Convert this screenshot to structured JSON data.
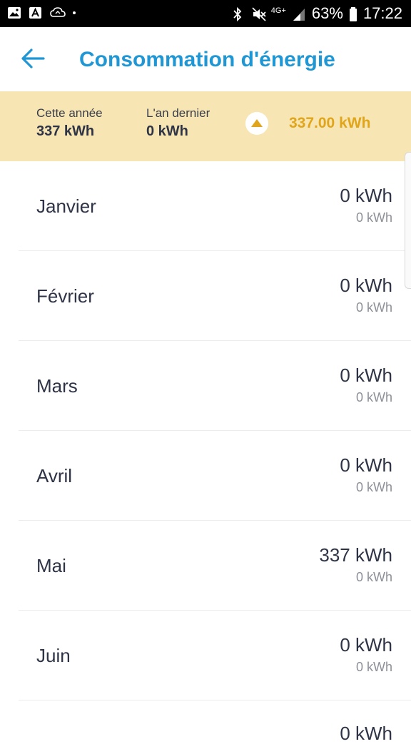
{
  "status_bar": {
    "battery": "63%",
    "time": "17:22",
    "network": "4G+",
    "icons": [
      "image-icon",
      "a-icon",
      "cloud-sync-icon",
      "dot-icon",
      "bluetooth-icon",
      "mute-icon",
      "signal-icon",
      "battery-icon"
    ]
  },
  "header": {
    "title": "Consommation d'énergie",
    "back_icon": "arrow-left-icon"
  },
  "summary": {
    "this_year_label": "Cette année",
    "this_year_value": "337 kWh",
    "last_year_label": "L'an dernier",
    "last_year_value": "0 kWh",
    "trend_icon": "triangle-up-icon",
    "difference": "337.00 kWh",
    "accent_color": "#e0a51a",
    "banner_color": "#f7e6b3"
  },
  "months": [
    {
      "name": "Janvier",
      "value": "0 kWh",
      "previous": "0 kWh"
    },
    {
      "name": "Février",
      "value": "0 kWh",
      "previous": "0 kWh"
    },
    {
      "name": "Mars",
      "value": "0 kWh",
      "previous": "0 kWh"
    },
    {
      "name": "Avril",
      "value": "0 kWh",
      "previous": "0 kWh"
    },
    {
      "name": "Mai",
      "value": "337 kWh",
      "previous": "0 kWh"
    },
    {
      "name": "Juin",
      "value": "0 kWh",
      "previous": "0 kWh"
    }
  ],
  "partial_next_value": "0 kWh",
  "colors": {
    "title": "#1f97d4",
    "text": "#2e3446",
    "secondary": "#8d9099"
  }
}
